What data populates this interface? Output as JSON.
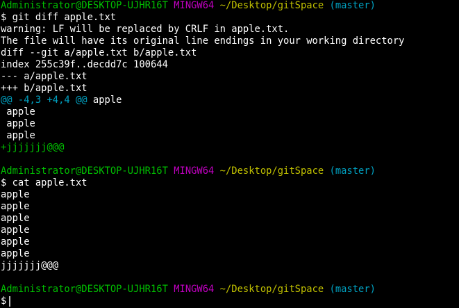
{
  "colors": {
    "background": "#000000",
    "default_text": "#c0c0c0",
    "user_host": "#00c000",
    "shell": "#c000c0",
    "path": "#c0c000",
    "branch": "#00a0c0",
    "bright_text": "#ffffff",
    "hunk_header": "#00a0c0",
    "added_line": "#00c000"
  },
  "lines": [
    [
      [
        "Administrator@DESKTOP-UJHR16T",
        "user_host"
      ],
      [
        " ",
        "default_text"
      ],
      [
        "MINGW64",
        "shell"
      ],
      [
        " ",
        "default_text"
      ],
      [
        "~/Desktop/gitSpace",
        "path"
      ],
      [
        " ",
        "default_text"
      ],
      [
        "(master)",
        "branch"
      ]
    ],
    [
      [
        "$ git diff apple.txt",
        "bright_text"
      ]
    ],
    [
      [
        "warning: LF will be replaced by CRLF in apple.txt.",
        "bright_text"
      ]
    ],
    [
      [
        "The file will have its original line endings in your working directory",
        "bright_text"
      ]
    ],
    [
      [
        "diff --git a/apple.txt b/apple.txt",
        "bright_text"
      ]
    ],
    [
      [
        "index 255c39f..decdd7c 100644",
        "bright_text"
      ]
    ],
    [
      [
        "--- a/apple.txt",
        "bright_text"
      ]
    ],
    [
      [
        "+++ b/apple.txt",
        "bright_text"
      ]
    ],
    [
      [
        "@@ -4,3 +4,4 @@",
        "hunk_header"
      ],
      [
        " apple",
        "bright_text"
      ]
    ],
    [
      [
        " apple",
        "bright_text"
      ]
    ],
    [
      [
        " apple",
        "bright_text"
      ]
    ],
    [
      [
        " apple",
        "bright_text"
      ]
    ],
    [
      [
        "+jjjjjjj@@@",
        "added_line"
      ]
    ],
    [],
    [
      [
        "Administrator@DESKTOP-UJHR16T",
        "user_host"
      ],
      [
        " ",
        "default_text"
      ],
      [
        "MINGW64",
        "shell"
      ],
      [
        " ",
        "default_text"
      ],
      [
        "~/Desktop/gitSpace",
        "path"
      ],
      [
        " ",
        "default_text"
      ],
      [
        "(master)",
        "branch"
      ]
    ],
    [
      [
        "$ cat apple.txt",
        "bright_text"
      ]
    ],
    [
      [
        "apple",
        "bright_text"
      ]
    ],
    [
      [
        "apple",
        "bright_text"
      ]
    ],
    [
      [
        "apple",
        "bright_text"
      ]
    ],
    [
      [
        "apple",
        "bright_text"
      ]
    ],
    [
      [
        "apple",
        "bright_text"
      ]
    ],
    [
      [
        "apple",
        "bright_text"
      ]
    ],
    [
      [
        "jjjjjjj@@@",
        "bright_text"
      ]
    ],
    [],
    [
      [
        "Administrator@DESKTOP-UJHR16T",
        "user_host"
      ],
      [
        " ",
        "default_text"
      ],
      [
        "MINGW64",
        "shell"
      ],
      [
        " ",
        "default_text"
      ],
      [
        "~/Desktop/gitSpace",
        "path"
      ],
      [
        " ",
        "default_text"
      ],
      [
        "(master)",
        "branch"
      ]
    ],
    [
      [
        "$",
        "bright_text"
      ]
    ]
  ]
}
